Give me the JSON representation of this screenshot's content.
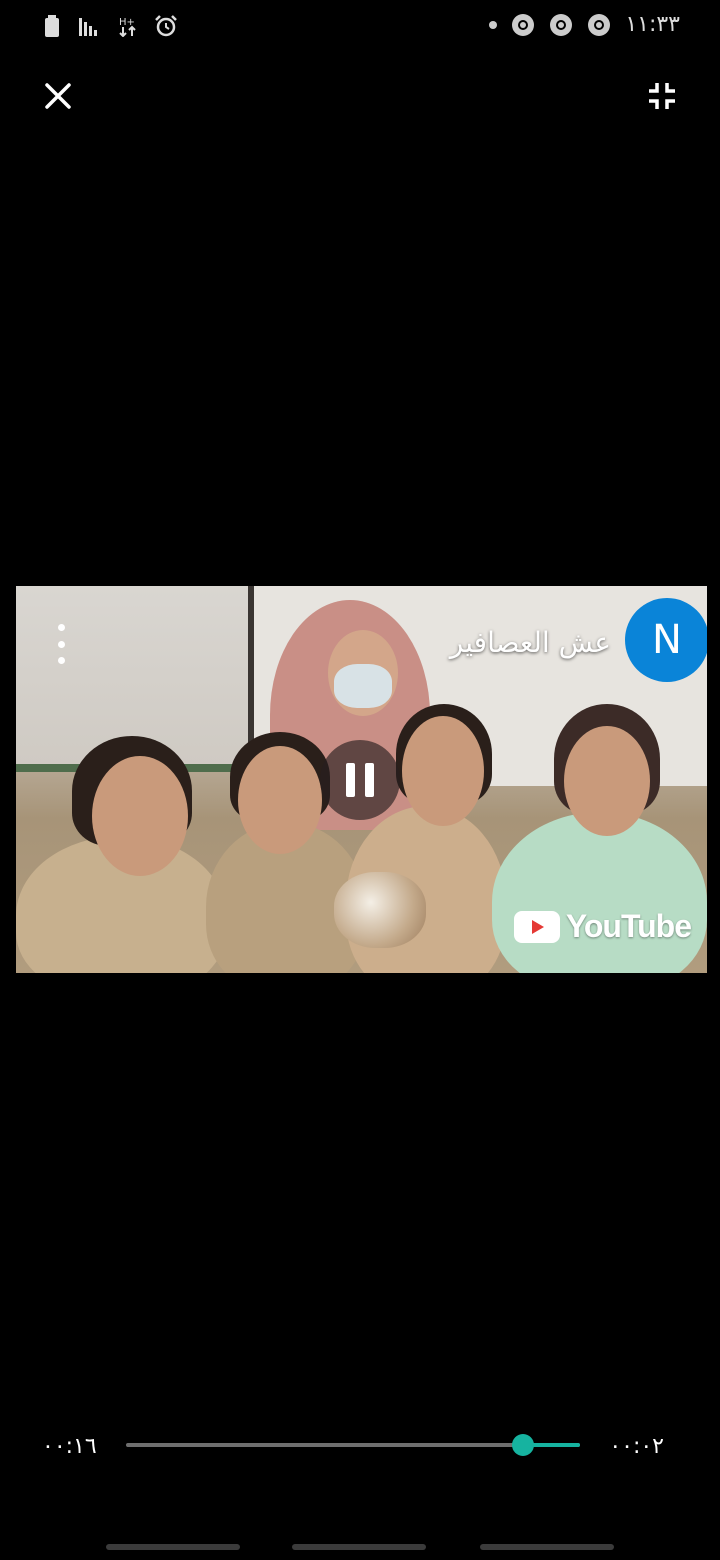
{
  "status_bar": {
    "time": "١١:٣٣",
    "left_icons": [
      "battery-icon",
      "signal-icon",
      "data-icon",
      "alarm-icon"
    ],
    "right_icons": [
      "notification-dot",
      "chrome-icon",
      "chrome-icon",
      "chrome-icon"
    ]
  },
  "player": {
    "video_title": "عش العصافير",
    "channel_initial": "N",
    "watermark": "YouTube",
    "state": "playing",
    "elapsed": "٠٠:٠٢",
    "duration": "٠٠:١٦",
    "progress": 0.125
  },
  "colors": {
    "accent": "#16b3a0",
    "avatar": "#0a84d8",
    "background": "#000000"
  }
}
